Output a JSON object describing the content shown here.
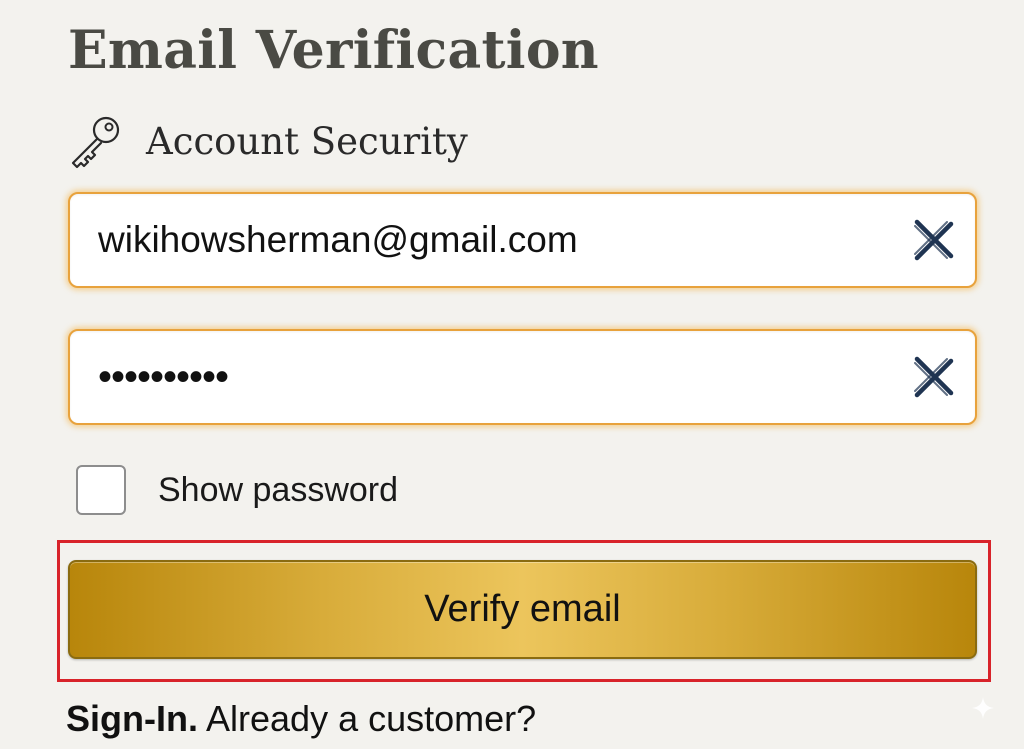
{
  "page": {
    "title": "Email Verification"
  },
  "security": {
    "icon": "key-icon",
    "label": "Account Security"
  },
  "form": {
    "email": {
      "value": "wikihowsherman@gmail.com",
      "clear_icon": "clear-icon"
    },
    "password": {
      "masked_value": "••••••••••",
      "clear_icon": "clear-icon"
    },
    "show_password": {
      "label": "Show password",
      "checked": false
    },
    "submit": {
      "label": "Verify email"
    }
  },
  "footer": {
    "signin_strong": "Sign-In.",
    "signin_rest": " Already a customer?"
  },
  "colors": {
    "background": "#f3f2ee",
    "field_focus_border": "#e8a23c",
    "button_gold": "#d8ac3a",
    "highlight_red": "#d8232a",
    "clear_icon": "#1f3452"
  }
}
